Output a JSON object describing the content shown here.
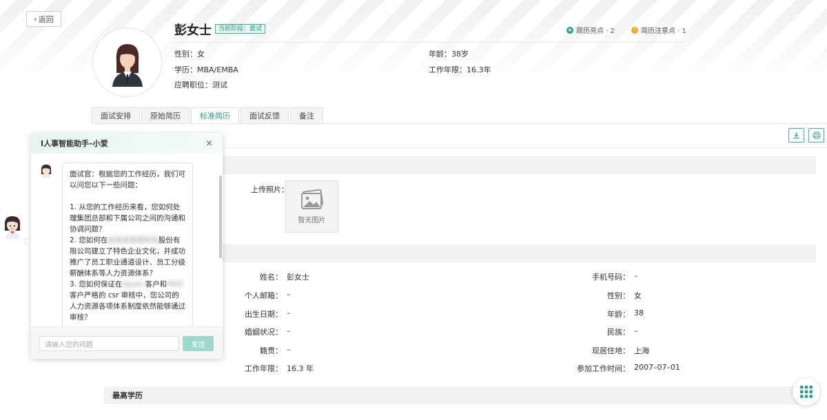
{
  "back_label": "返回",
  "candidate": {
    "name": "彭女士",
    "stage_badge": "当前阶段：面试",
    "highlights_label": "简历亮点 · 2",
    "attention_label": "简历注意点 · 1",
    "gender_line": "性别：女",
    "age_line": "年龄：38岁",
    "education_line": "学历：MBA/EMBA",
    "work_years_line": "工作年限：16.3年",
    "position_line": "应聘职位：测试"
  },
  "tabs": [
    {
      "label": "面试安排",
      "active": false
    },
    {
      "label": "原始简历",
      "active": false
    },
    {
      "label": "标准简历",
      "active": true
    },
    {
      "label": "面试反馈",
      "active": false
    },
    {
      "label": "备注",
      "active": false
    }
  ],
  "photo": {
    "label": "上传照片：",
    "empty_text": "暂无图片"
  },
  "basic_info": {
    "left": [
      {
        "label": "姓名：",
        "value": "彭女士"
      },
      {
        "label": "个人邮箱：",
        "value": "–"
      },
      {
        "label": "出生日期：",
        "value": "–"
      },
      {
        "label": "婚姻状况：",
        "value": "–"
      },
      {
        "label": "籍贯：",
        "value": "–"
      },
      {
        "label": "工作年限：",
        "value": "16.3 年"
      }
    ],
    "right": [
      {
        "label": "手机号码：",
        "value": "–"
      },
      {
        "label": "性别：",
        "value": "女"
      },
      {
        "label": "年龄：",
        "value": "38"
      },
      {
        "label": "民族：",
        "value": "–"
      },
      {
        "label": "现居住地：",
        "value": "上海"
      },
      {
        "label": "参加工作时间：",
        "value": "2007–07–01"
      }
    ]
  },
  "section_highest_education": "最高学历",
  "chat": {
    "title": "I人事智能助手–小爱",
    "message_intro": "面试官：根据您的工作经历，我们可以问您以下一些问题：",
    "q1": "1. 从您的工作经历来看，您如何处理集团总部和下属公司之间的沟通和协调问题？",
    "q2_pre": "2. 您如何在",
    "q2_blur": "某某某管理有限",
    "q2_post": "股份有限公司建立了特色企业文化，并成功推广了员工职业通道设计、员工分级薪酬体系等人力资源体系？",
    "q3_pre": "3. 您如何保证在",
    "q3_blur1": "Apple",
    "q3_mid": "客户和",
    "q3_blur2": "NIKE",
    "q3_post": "客户严格的 csr 审核中，您公司的人力资源各项体系制度依然能够通过审核？",
    "input_placeholder": "请输入您的问题",
    "send_label": "发送"
  },
  "colors": {
    "accent": "#2a9d8f",
    "highlight_dot": "#2a9d8f",
    "attention_dot": "#f5a623"
  }
}
